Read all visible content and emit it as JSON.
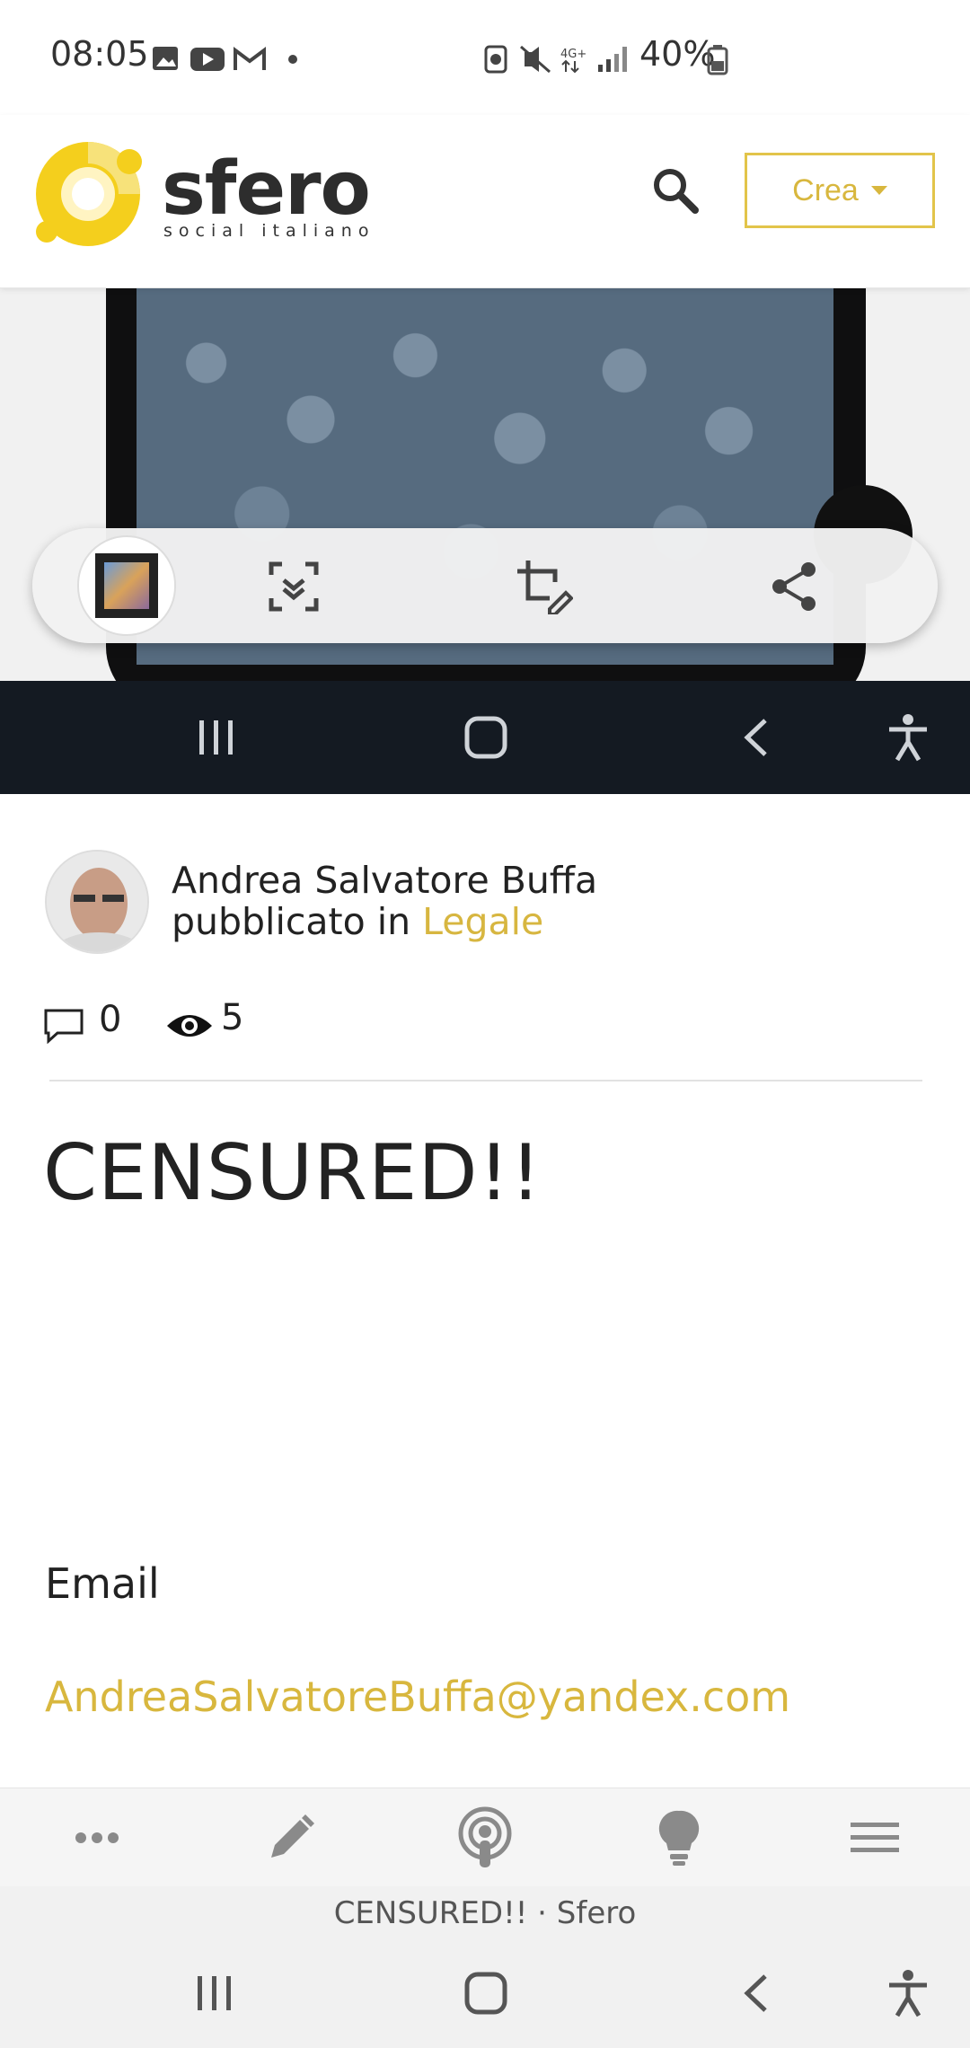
{
  "status_bar": {
    "time": "08:05",
    "battery": "40%"
  },
  "header": {
    "brand_name": "sfero",
    "brand_tagline": "social italiano",
    "create_button": "Crea",
    "accent_color": "#d8b73e"
  },
  "embedded_screenshot": {
    "toolbar_icons": [
      "scan-icon",
      "crop-edit-icon",
      "share-icon"
    ],
    "navbar_icons": [
      "recents-icon",
      "home-icon",
      "back-icon",
      "accessibility-icon"
    ]
  },
  "post": {
    "author": "Andrea Salvatore Buffa",
    "published_prefix": "pubblicato in",
    "category": "Legale",
    "comments_count": "0",
    "views_count": "5",
    "title": "CENSURED!!",
    "email_label": "Email",
    "email": "AndreaSalvatoreBuffa@yandex.com"
  },
  "bottom_nav": {
    "items": [
      "more-icon",
      "pencil-icon",
      "podcast-icon",
      "lightbulb-icon",
      "menu-icon"
    ]
  },
  "browser": {
    "page_title": "CENSURED!! · Sfero"
  },
  "system_nav": {
    "icons": [
      "recents-icon",
      "home-icon",
      "back-icon",
      "accessibility-icon"
    ]
  }
}
